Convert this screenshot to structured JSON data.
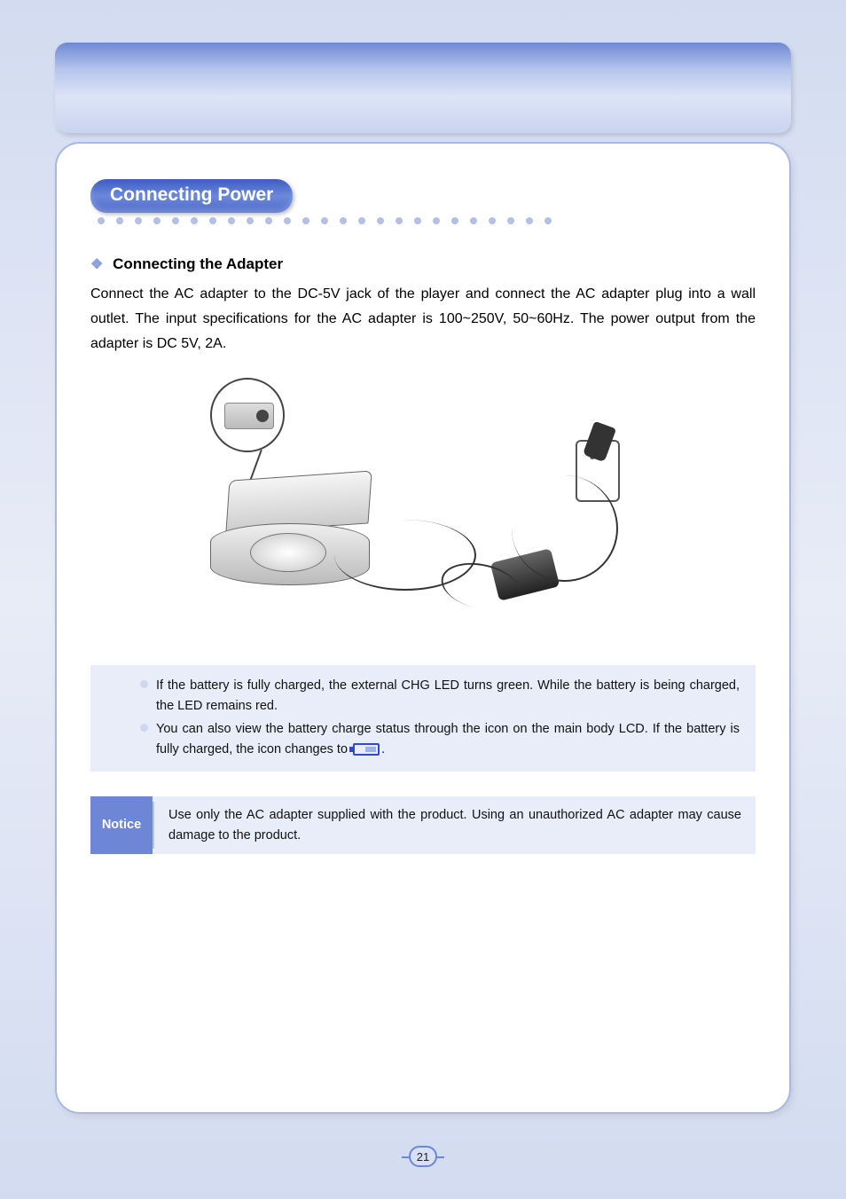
{
  "header": {
    "section_title": "Connecting Power"
  },
  "sub": {
    "title": "Connecting the Adapter"
  },
  "body": {
    "paragraph": "Connect the AC adapter to the DC-5V jack of the player and connect the AC adapter plug into a wall outlet. The input specifications for the AC adapter is 100~250V, 50~60Hz. The power output from the adapter is DC 5V, 2A."
  },
  "tips": {
    "items": [
      "If the battery is fully charged, the external CHG LED turns green. While the battery is being charged, the LED remains red.",
      "You can also view the battery charge status through the icon on the main body LCD. If the battery is fully charged, the icon changes to"
    ],
    "tail_punct": "."
  },
  "notice": {
    "label": "Notice",
    "text": "Use only the AC adapter supplied with the product. Using an unauthorized AC adapter may cause damage to the product."
  },
  "page": {
    "number": "21"
  }
}
